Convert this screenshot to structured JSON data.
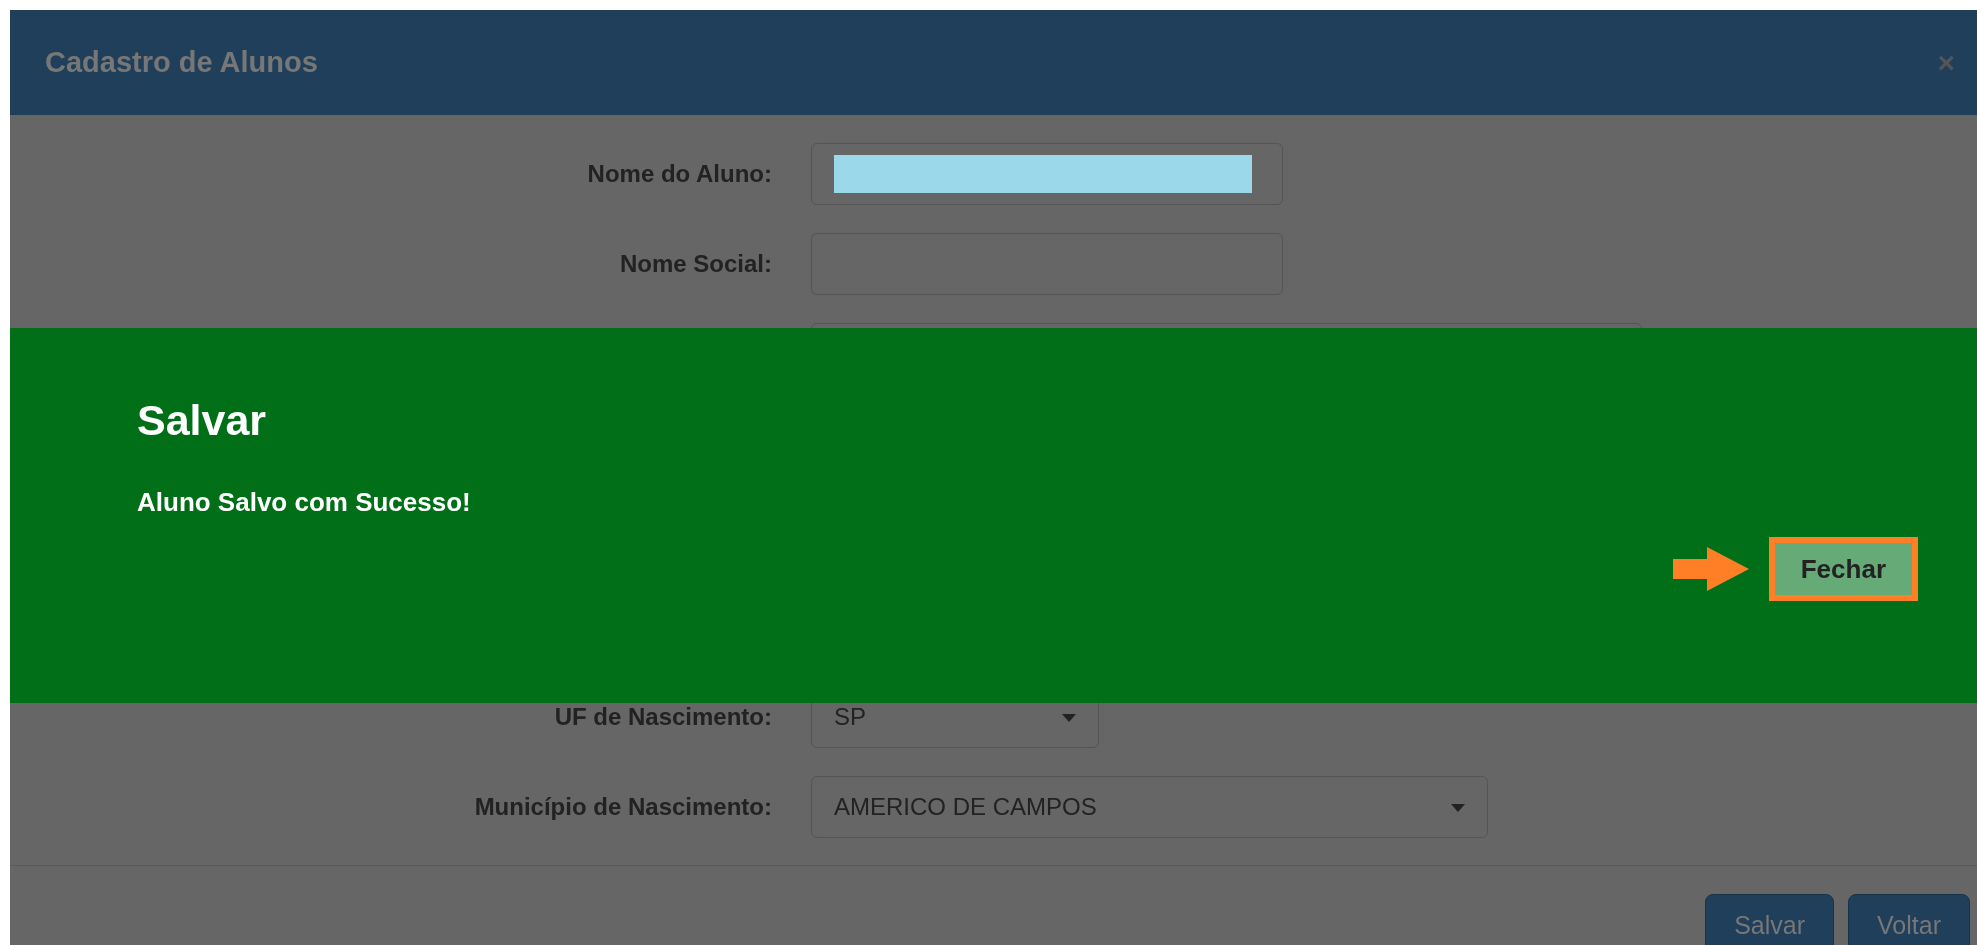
{
  "modal": {
    "title": "Cadastro de Alunos",
    "close": "×"
  },
  "fields": [
    {
      "kind": "text",
      "label": "Nome do Aluno:",
      "redacted": true
    },
    {
      "kind": "text",
      "label": "Nome Social:",
      "redacted": false
    },
    {
      "kind": "partial"
    },
    {
      "kind": "select",
      "label": "UF de Nascimento:",
      "value": "SP"
    },
    {
      "kind": "select",
      "label": "Município de Nascimento:",
      "value": "AMERICO DE CAMPOS"
    }
  ],
  "alert": {
    "title": "Salvar",
    "message": "Aluno Salvo com Sucesso!",
    "button": "Fechar",
    "highlighted": true
  },
  "footer_buttons": [
    "Salvar",
    "Voltar"
  ]
}
